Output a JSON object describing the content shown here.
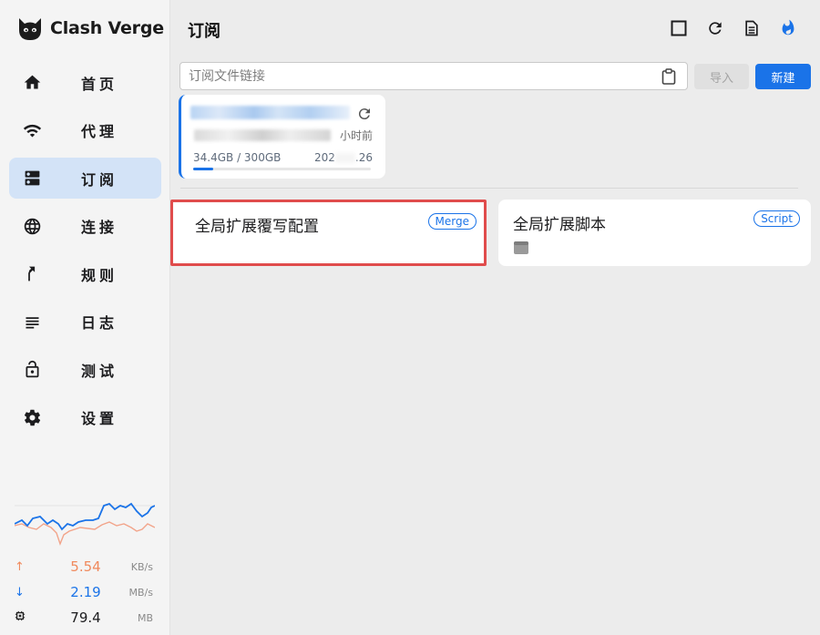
{
  "app": {
    "name": "Clash Verge"
  },
  "nav": [
    {
      "label": "首页",
      "icon": "home-icon"
    },
    {
      "label": "代理",
      "icon": "wifi-icon"
    },
    {
      "label": "订阅",
      "icon": "dns-icon",
      "active": true
    },
    {
      "label": "连接",
      "icon": "globe-icon"
    },
    {
      "label": "规则",
      "icon": "fork-icon"
    },
    {
      "label": "日志",
      "icon": "list-icon"
    },
    {
      "label": "测试",
      "icon": "lock-icon"
    },
    {
      "label": "设置",
      "icon": "gear-icon"
    }
  ],
  "traffic": {
    "upload": {
      "value": "5.54",
      "unit": "KB/s",
      "color": "#f08a5d"
    },
    "download": {
      "value": "2.19",
      "unit": "MB/s",
      "color": "#1a73e8"
    },
    "memory": {
      "value": "79.4",
      "unit": "MB"
    }
  },
  "header": {
    "title": "订阅"
  },
  "subscribe": {
    "placeholder": "订阅文件链接",
    "import_label": "导入",
    "new_label": "新建"
  },
  "profile": {
    "updated": "小时前",
    "usage": "34.4GB / 300GB",
    "expire_prefix": "202",
    "expire_suffix": ".26",
    "usage_fraction": 0.115
  },
  "enhanced": [
    {
      "title": "全局扩展覆写配置",
      "tag": "Merge"
    },
    {
      "title": "全局扩展脚本",
      "tag": "Script"
    }
  ],
  "colors": {
    "accent": "#1a73e8",
    "highlight": "#e04c4c"
  }
}
